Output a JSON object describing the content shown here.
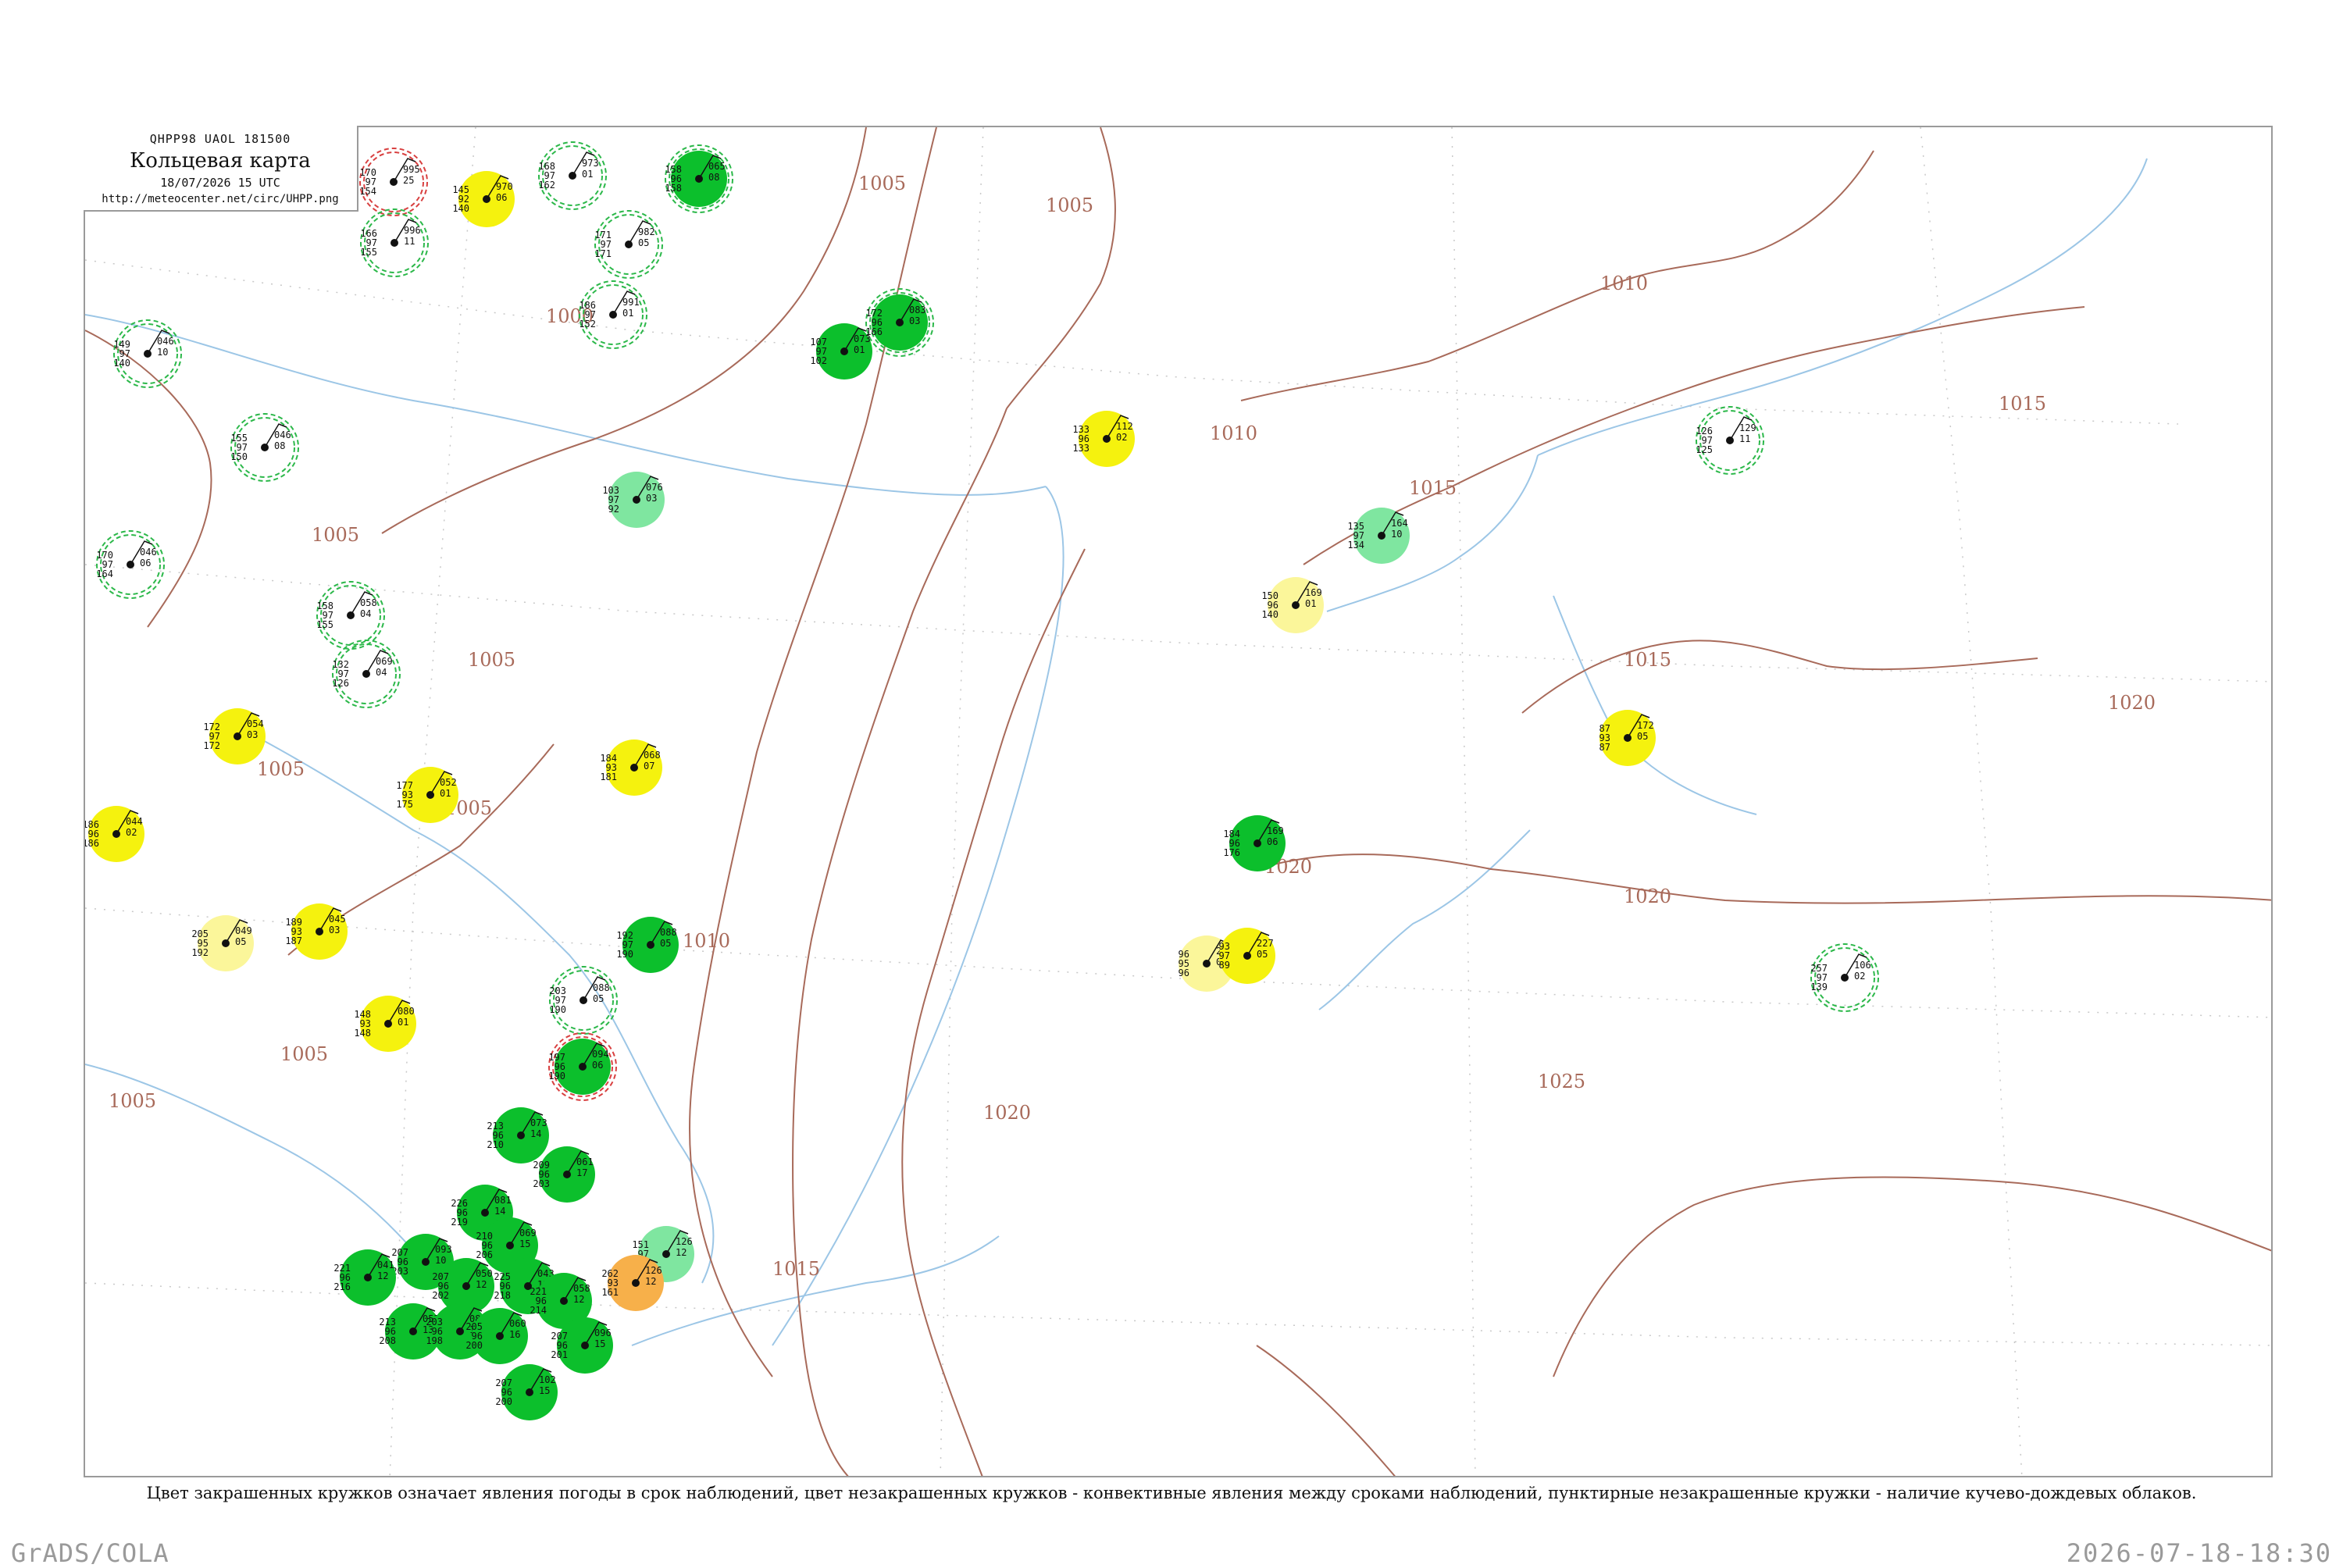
{
  "header": {
    "code": "QHPP98  UAOL  181500",
    "title": "Кольцевая карта",
    "datetime": "18/07/2026 15 UTC",
    "url": "http://meteocenter.net/circ/UHPP.png"
  },
  "legend_note": "Цвет закрашенных кружков означает явления погоды в срок наблюдений, цвет незакрашенных кружков - конвективные явления между сроками наблюдений, пунктирные незакрашенные кружки - наличие кучево-дождевых облаков.",
  "footer": {
    "left": "GrADS/COLA",
    "right": "2026-07-18-18:30"
  },
  "colors": {
    "isobar": "#a86a5a",
    "coast": "#9cc6e6",
    "grid": "#c8c8c8",
    "green_dark": "#0cbf2c",
    "green_light": "#7fe6a0",
    "yellow": "#f5f20e",
    "pale_yellow": "#fbf69a",
    "orange": "#f7b04a",
    "dashed_ring": "#2cb84a",
    "red_ring": "#d84040"
  },
  "isobar_labels": [
    {
      "text": "1005",
      "id": "a"
    },
    {
      "text": "1005",
      "id": "b"
    },
    {
      "text": "1005",
      "id": "c"
    },
    {
      "text": "1005",
      "id": "d"
    },
    {
      "text": "1005",
      "id": "e"
    },
    {
      "text": "1005",
      "id": "f"
    },
    {
      "text": "1005",
      "id": "g"
    },
    {
      "text": "1005",
      "id": "h"
    },
    {
      "text": "1000",
      "id": "i"
    },
    {
      "text": "1010",
      "id": "j"
    },
    {
      "text": "1010",
      "id": "k"
    },
    {
      "text": "1010",
      "id": "l"
    },
    {
      "text": "1015",
      "id": "m"
    },
    {
      "text": "1015",
      "id": "n"
    },
    {
      "text": "1015",
      "id": "o"
    },
    {
      "text": "1015",
      "id": "p"
    },
    {
      "text": "1020",
      "id": "q"
    },
    {
      "text": "1020",
      "id": "r"
    },
    {
      "text": "1020",
      "id": "s"
    },
    {
      "text": "1020",
      "id": "t"
    },
    {
      "text": "1025",
      "id": "u"
    }
  ],
  "stations": [
    {
      "id": "s01",
      "fill": "none",
      "ring": "red",
      "top": "995",
      "left": "170",
      "mid": "97",
      "bot": "154",
      "right": "25"
    },
    {
      "id": "s02",
      "fill": "yellow",
      "ring": "none",
      "top": "970",
      "left": "145",
      "mid": "92",
      "bot": "140",
      "right": "06"
    },
    {
      "id": "s03",
      "fill": "none",
      "ring": "dashed",
      "top": "973",
      "left": "168",
      "mid": "97",
      "bot": "162",
      "right": "01"
    },
    {
      "id": "s04",
      "fill": "green_dark",
      "ring": "dashed",
      "top": "065",
      "left": "158",
      "mid": "96",
      "bot": "158",
      "right": "08"
    },
    {
      "id": "s05",
      "fill": "none",
      "ring": "dashed",
      "top": "996",
      "left": "166",
      "mid": "97",
      "bot": "155",
      "right": "11"
    },
    {
      "id": "s06",
      "fill": "none",
      "ring": "dashed",
      "top": "982",
      "left": "171",
      "mid": "97",
      "bot": "171",
      "right": "05"
    },
    {
      "id": "s07",
      "fill": "none",
      "ring": "dashed",
      "top": "991",
      "left": "186",
      "mid": "97",
      "bot": "152",
      "right": "01"
    },
    {
      "id": "s08",
      "fill": "none",
      "ring": "dashed",
      "top": "046",
      "left": "149",
      "mid": "97",
      "bot": "140",
      "right": "10"
    },
    {
      "id": "s09",
      "fill": "none",
      "ring": "dashed",
      "top": "046",
      "left": "155",
      "mid": "97",
      "bot": "150",
      "right": "08"
    },
    {
      "id": "s10",
      "fill": "none",
      "ring": "dashed",
      "top": "046",
      "left": "170",
      "mid": "97",
      "bot": "164",
      "right": "06"
    },
    {
      "id": "s11",
      "fill": "none",
      "ring": "dashed",
      "top": "058",
      "left": "158",
      "mid": "97",
      "bot": "155",
      "right": "04"
    },
    {
      "id": "s12",
      "fill": "none",
      "ring": "dashed",
      "top": "069",
      "left": "132",
      "mid": "97",
      "bot": "126",
      "right": "04"
    },
    {
      "id": "s13",
      "fill": "green_dark",
      "ring": "dashed",
      "top": "083",
      "left": "172",
      "mid": "96",
      "bot": "166",
      "right": "03"
    },
    {
      "id": "s14",
      "fill": "green_dark",
      "ring": "none",
      "top": "073",
      "left": "107",
      "mid": "97",
      "bot": "102",
      "right": "01"
    },
    {
      "id": "s15",
      "fill": "green_light",
      "ring": "none",
      "top": "076",
      "left": "103",
      "mid": "97",
      "bot": "92",
      "right": "03"
    },
    {
      "id": "s16",
      "fill": "yellow",
      "ring": "none",
      "top": "112",
      "left": "133",
      "mid": "96",
      "bot": "133",
      "right": "02"
    },
    {
      "id": "s17",
      "fill": "green_light",
      "ring": "none",
      "top": "164",
      "left": "135",
      "mid": "97",
      "bot": "134",
      "right": "10"
    },
    {
      "id": "s18",
      "fill": "pale_yellow",
      "ring": "none",
      "top": "169",
      "left": "150",
      "mid": "96",
      "bot": "140",
      "right": "01"
    },
    {
      "id": "s19",
      "fill": "none",
      "ring": "dashed",
      "top": "129",
      "left": "126",
      "mid": "97",
      "bot": "125",
      "right": "11"
    },
    {
      "id": "s20",
      "fill": "yellow",
      "ring": "none",
      "top": "172",
      "left": "87",
      "mid": "93",
      "bot": "87",
      "right": "05"
    },
    {
      "id": "s21",
      "fill": "yellow",
      "ring": "none",
      "top": "054",
      "left": "172",
      "mid": "97",
      "bot": "172",
      "right": "03"
    },
    {
      "id": "s22",
      "fill": "yellow",
      "ring": "none",
      "top": "068",
      "left": "184",
      "mid": "93",
      "bot": "181",
      "right": "07"
    },
    {
      "id": "s23",
      "fill": "yellow",
      "ring": "none",
      "top": "052",
      "left": "177",
      "mid": "93",
      "bot": "175",
      "right": "01"
    },
    {
      "id": "s24",
      "fill": "yellow",
      "ring": "none",
      "top": "044",
      "left": "186",
      "mid": "96",
      "bot": "186",
      "right": "02"
    },
    {
      "id": "s25",
      "fill": "pale_yellow",
      "ring": "none",
      "top": "049",
      "left": "205",
      "mid": "95",
      "bot": "192",
      "right": "05"
    },
    {
      "id": "s26",
      "fill": "yellow",
      "ring": "none",
      "top": "045",
      "left": "189",
      "mid": "93",
      "bot": "187",
      "right": "03"
    },
    {
      "id": "s27",
      "fill": "yellow",
      "ring": "none",
      "top": "080",
      "left": "148",
      "mid": "93",
      "bot": "148",
      "right": "01"
    },
    {
      "id": "s28",
      "fill": "green_dark",
      "ring": "none",
      "top": "088",
      "left": "192",
      "mid": "97",
      "bot": "190",
      "right": "05"
    },
    {
      "id": "s29",
      "fill": "none",
      "ring": "dashed",
      "top": "088",
      "left": "203",
      "mid": "97",
      "bot": "190",
      "right": "05"
    },
    {
      "id": "s30",
      "fill": "green_dark",
      "ring": "red",
      "top": "094",
      "left": "197",
      "mid": "96",
      "bot": "190",
      "right": "06"
    },
    {
      "id": "s31",
      "fill": "green_dark",
      "ring": "none",
      "top": "169",
      "left": "184",
      "mid": "96",
      "bot": "176",
      "right": "06"
    },
    {
      "id": "s32",
      "fill": "pale_yellow",
      "ring": "none",
      "top": "230",
      "left": "96",
      "mid": "95",
      "bot": "96",
      "right": "02"
    },
    {
      "id": "s33",
      "fill": "yellow",
      "ring": "none",
      "top": "227",
      "left": "93",
      "mid": "97",
      "bot": "89",
      "right": "05"
    },
    {
      "id": "s34",
      "fill": "none",
      "ring": "dashed",
      "top": "106",
      "left": "257",
      "mid": "97",
      "bot": "139",
      "right": "02"
    },
    {
      "id": "s35",
      "fill": "green_light",
      "ring": "none",
      "top": "126",
      "left": "151",
      "mid": "97",
      "bot": "151",
      "right": "12"
    },
    {
      "id": "s36",
      "fill": "orange",
      "ring": "none",
      "top": "126",
      "left": "262",
      "mid": "93",
      "bot": "161",
      "right": "12"
    },
    {
      "id": "s37",
      "fill": "green_dark",
      "ring": "none",
      "top": "073",
      "left": "213",
      "mid": "96",
      "bot": "210",
      "right": "14"
    },
    {
      "id": "s38",
      "fill": "green_dark",
      "ring": "none",
      "top": "061",
      "left": "209",
      "mid": "96",
      "bot": "203",
      "right": "17"
    },
    {
      "id": "s39",
      "fill": "green_dark",
      "ring": "none",
      "top": "081",
      "left": "226",
      "mid": "96",
      "bot": "219",
      "right": "14"
    },
    {
      "id": "s40",
      "fill": "green_dark",
      "ring": "none",
      "top": "069",
      "left": "210",
      "mid": "96",
      "bot": "206",
      "right": "15"
    },
    {
      "id": "s41",
      "fill": "green_dark",
      "ring": "none",
      "top": "093",
      "left": "207",
      "mid": "96",
      "bot": "203",
      "right": "10"
    },
    {
      "id": "s42",
      "fill": "green_dark",
      "ring": "none",
      "top": "050",
      "left": "207",
      "mid": "96",
      "bot": "202",
      "right": "12"
    },
    {
      "id": "s43",
      "fill": "green_dark",
      "ring": "none",
      "top": "043",
      "left": "225",
      "mid": "96",
      "bot": "218",
      "right": "13"
    },
    {
      "id": "s44",
      "fill": "green_dark",
      "ring": "none",
      "top": "058",
      "left": "221",
      "mid": "96",
      "bot": "214",
      "right": "12"
    },
    {
      "id": "s45",
      "fill": "green_dark",
      "ring": "none",
      "top": "041",
      "left": "221",
      "mid": "96",
      "bot": "216",
      "right": "12"
    },
    {
      "id": "s46",
      "fill": "green_dark",
      "ring": "none",
      "top": "053",
      "left": "213",
      "mid": "96",
      "bot": "208",
      "right": "13"
    },
    {
      "id": "s47",
      "fill": "green_dark",
      "ring": "none",
      "top": "089",
      "left": "203",
      "mid": "96",
      "bot": "198",
      "right": "13"
    },
    {
      "id": "s48",
      "fill": "green_dark",
      "ring": "none",
      "top": "060",
      "left": "205",
      "mid": "96",
      "bot": "200",
      "right": "16"
    },
    {
      "id": "s49",
      "fill": "green_dark",
      "ring": "none",
      "top": "096",
      "left": "207",
      "mid": "96",
      "bot": "201",
      "right": "15"
    },
    {
      "id": "s50",
      "fill": "green_dark",
      "ring": "none",
      "top": "102",
      "left": "207",
      "mid": "96",
      "bot": "200",
      "right": "15"
    }
  ]
}
